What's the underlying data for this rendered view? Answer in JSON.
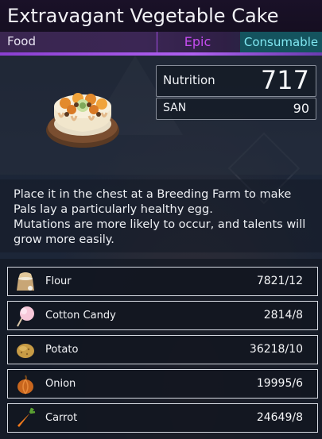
{
  "item": {
    "title": "Extravagant Vegetable Cake",
    "category": "Food",
    "rarity": "Epic",
    "type": "Consumable"
  },
  "stats": {
    "nutrition_label": "Nutrition",
    "nutrition_value": "717",
    "san_label": "SAN",
    "san_value": "90"
  },
  "description": "Place it in the chest at a Breeding Farm to make Pals lay a particularly healthy egg.\nMutations are more likely to occur, and talents will grow more easily.",
  "ingredients": [
    {
      "name": "Flour",
      "count": "7821/12",
      "icon": "flour-icon"
    },
    {
      "name": "Cotton Candy",
      "count": "2814/8",
      "icon": "cotton-candy-icon"
    },
    {
      "name": "Potato",
      "count": "36218/10",
      "icon": "potato-icon"
    },
    {
      "name": "Onion",
      "count": "19995/6",
      "icon": "onion-icon"
    },
    {
      "name": "Carrot",
      "count": "24649/8",
      "icon": "carrot-icon"
    }
  ],
  "colors": {
    "rarity_epic": "#c64df0",
    "type_consumable": "#7fe6f0",
    "accent_line": "#b061f0"
  }
}
